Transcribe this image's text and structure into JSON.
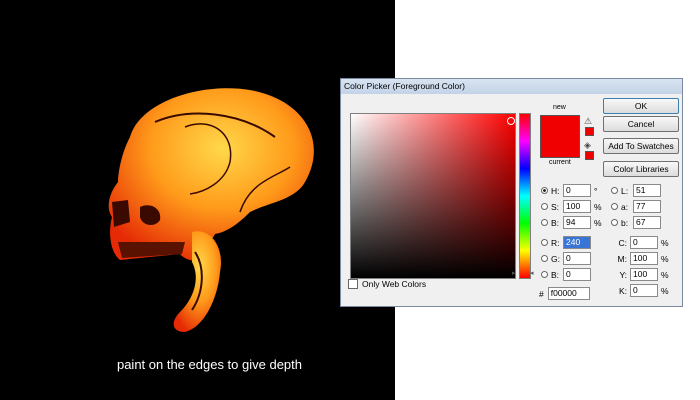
{
  "caption": "paint on the edges to give depth",
  "dialog": {
    "title": "Color Picker (Foreground Color)",
    "new_label": "new",
    "current_label": "current",
    "only_web_colors_label": "Only Web Colors",
    "buttons": {
      "ok": "OK",
      "cancel": "Cancel",
      "add_to_swatches": "Add To Swatches",
      "color_libraries": "Color Libraries"
    },
    "hsb": [
      {
        "label": "H:",
        "value": "0",
        "unit": "°",
        "selected": true
      },
      {
        "label": "S:",
        "value": "100",
        "unit": "%",
        "selected": false
      },
      {
        "label": "B:",
        "value": "94",
        "unit": "%",
        "selected": false
      }
    ],
    "rgb": [
      {
        "label": "R:",
        "value": "240",
        "selected": false,
        "highlighted": true
      },
      {
        "label": "G:",
        "value": "0",
        "selected": false
      },
      {
        "label": "B:",
        "value": "0",
        "selected": false
      }
    ],
    "lab": [
      {
        "label": "L:",
        "value": "51"
      },
      {
        "label": "a:",
        "value": "77"
      },
      {
        "label": "b:",
        "value": "67"
      }
    ],
    "cmyk": [
      {
        "label": "C:",
        "value": "0",
        "unit": "%"
      },
      {
        "label": "M:",
        "value": "100",
        "unit": "%"
      },
      {
        "label": "Y:",
        "value": "100",
        "unit": "%"
      },
      {
        "label": "K:",
        "value": "0",
        "unit": "%"
      }
    ],
    "hex_label": "#",
    "hex_value": "f00000",
    "colors": {
      "new": "#f00000",
      "current": "#f00000"
    }
  }
}
